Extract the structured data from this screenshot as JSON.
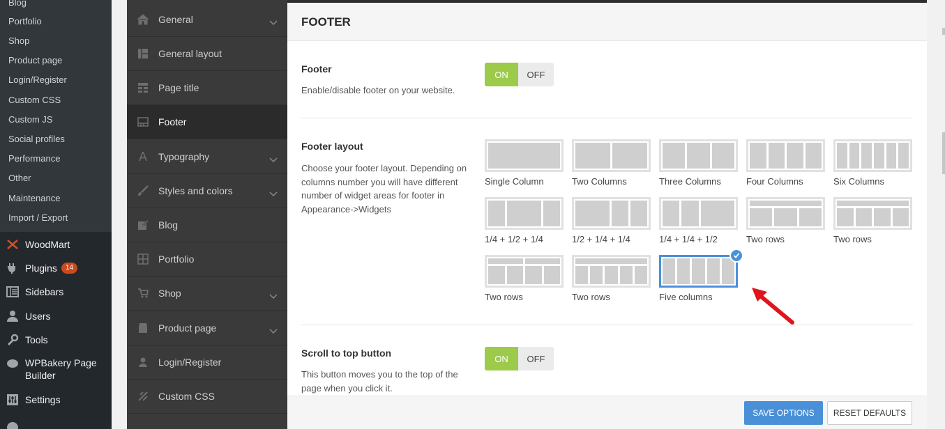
{
  "wp_sidebar": {
    "sub_items": [
      "Blog",
      "Portfolio",
      "Shop",
      "Product page",
      "Login/Register",
      "Custom CSS",
      "Custom JS",
      "Social profiles",
      "Performance",
      "Other",
      "Maintenance",
      "Import / Export"
    ],
    "main_items": [
      {
        "label": "WoodMart",
        "icon": "woodmart-icon"
      },
      {
        "label": "Plugins",
        "icon": "plugins-icon",
        "badge": "14"
      },
      {
        "label": "Sidebars",
        "icon": "sidebars-icon"
      },
      {
        "label": "Users",
        "icon": "users-icon"
      },
      {
        "label": "Tools",
        "icon": "tools-icon"
      },
      {
        "label": "WPBakery Page",
        "label2": "Builder",
        "icon": "wpbakery-icon"
      },
      {
        "label": "Settings",
        "icon": "settings-icon"
      }
    ]
  },
  "options_nav": {
    "items": [
      {
        "label": "General",
        "icon": "home-icon",
        "has_submenu": true
      },
      {
        "label": "General layout",
        "icon": "layout-icon",
        "has_submenu": false
      },
      {
        "label": "Page title",
        "icon": "page-title-icon",
        "has_submenu": false
      },
      {
        "label": "Footer",
        "icon": "footer-icon",
        "has_submenu": false,
        "active": true
      },
      {
        "label": "Typography",
        "icon": "typography-icon",
        "has_submenu": true
      },
      {
        "label": "Styles and colors",
        "icon": "brush-icon",
        "has_submenu": true
      },
      {
        "label": "Blog",
        "icon": "edit-icon",
        "has_submenu": false
      },
      {
        "label": "Portfolio",
        "icon": "grid-icon",
        "has_submenu": false
      },
      {
        "label": "Shop",
        "icon": "cart-icon",
        "has_submenu": true
      },
      {
        "label": "Product page",
        "icon": "store-icon",
        "has_submenu": true
      },
      {
        "label": "Login/Register",
        "icon": "user-icon",
        "has_submenu": false
      },
      {
        "label": "Custom CSS",
        "icon": "css-icon",
        "has_submenu": false
      }
    ]
  },
  "page": {
    "title": "FOOTER"
  },
  "footer_field": {
    "title": "Footer",
    "desc": "Enable/disable footer on your website.",
    "on": "ON",
    "off": "OFF",
    "value": "ON"
  },
  "layout_field": {
    "title": "Footer layout",
    "desc_lines": [
      "Choose your footer layout. Depending on",
      "columns number you will have different",
      "number of widget areas for footer in",
      "Appearance->Widgets"
    ],
    "options": [
      {
        "label": "Single Column"
      },
      {
        "label": "Two Columns"
      },
      {
        "label": "Three Columns"
      },
      {
        "label": "Four Columns"
      },
      {
        "label": "Six Columns"
      },
      {
        "label": "1/4 + 1/2 + 1/4"
      },
      {
        "label": "1/2 + 1/4 + 1/4"
      },
      {
        "label": "1/4 + 1/4 + 1/2"
      },
      {
        "label": "Two rows"
      },
      {
        "label": "Two rows"
      },
      {
        "label": "Two rows"
      },
      {
        "label": "Two rows"
      },
      {
        "label": "Five columns",
        "selected": true
      }
    ]
  },
  "scroll_field": {
    "title": "Scroll to top button",
    "desc_lines": [
      "This button moves you to the top of the",
      "page when you click it."
    ],
    "on": "ON",
    "off": "OFF",
    "value": "ON"
  },
  "actions": {
    "save": "SAVE OPTIONS",
    "reset": "RESET DEFAULTS"
  },
  "colors": {
    "switch_on": "#9cca4b",
    "accent_blue": "#4a90d9",
    "arrow": "#e0141b"
  }
}
